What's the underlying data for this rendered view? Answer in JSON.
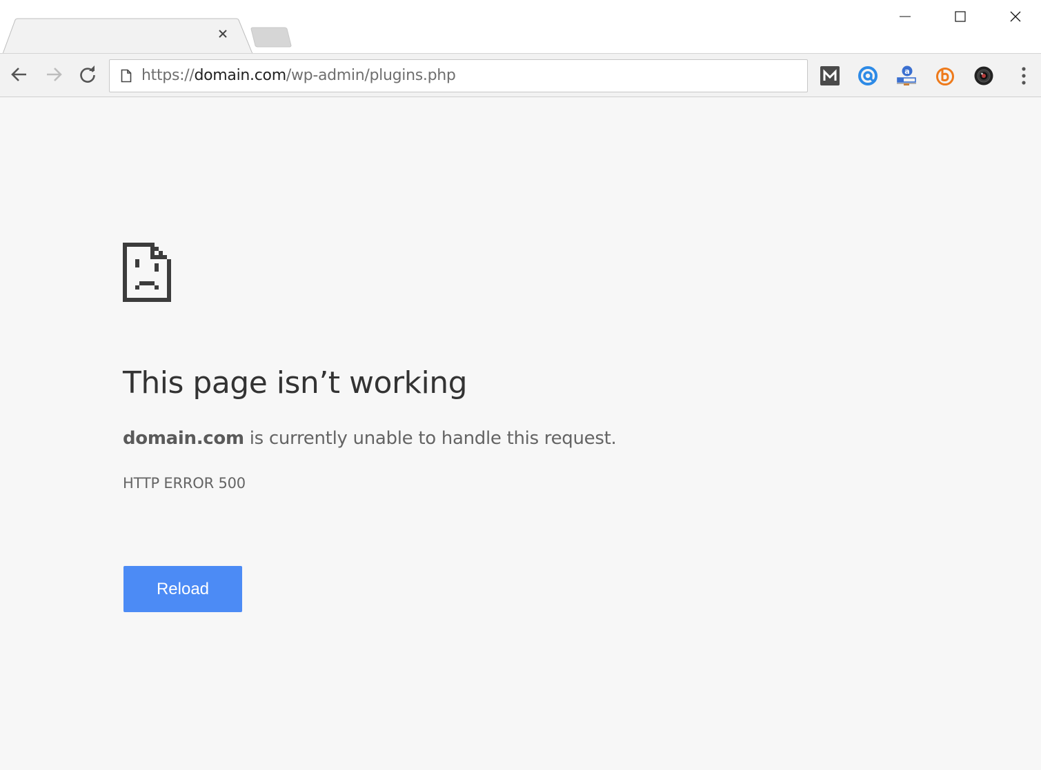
{
  "tab": {
    "title": "",
    "close_icon": "close-icon"
  },
  "window_controls": [
    "minimize-icon",
    "maximize-icon",
    "close-icon"
  ],
  "toolbar": {
    "back_icon": "arrow-left-icon",
    "forward_icon": "arrow-right-icon",
    "reload_icon": "reload-icon",
    "url": {
      "scheme": "https://",
      "host": "domain.com",
      "path": "/wp-admin/plugins.php"
    },
    "extensions": [
      "extension-m-icon",
      "extension-at-icon",
      "extension-a-icon",
      "extension-b-icon",
      "extension-camera-icon"
    ],
    "menu_icon": "kebab-menu-icon"
  },
  "error_page": {
    "icon": "sad-page-icon",
    "title": "This page isn’t working",
    "summary_host": "domain.com",
    "summary_text": " is currently unable to handle this request.",
    "error_code": "HTTP ERROR 500",
    "reload_label": "Reload"
  },
  "colors": {
    "page_background": "#f7f7f7",
    "reload_button": "#4c8bf5",
    "headline_text": "#333333",
    "body_text": "#646464"
  }
}
